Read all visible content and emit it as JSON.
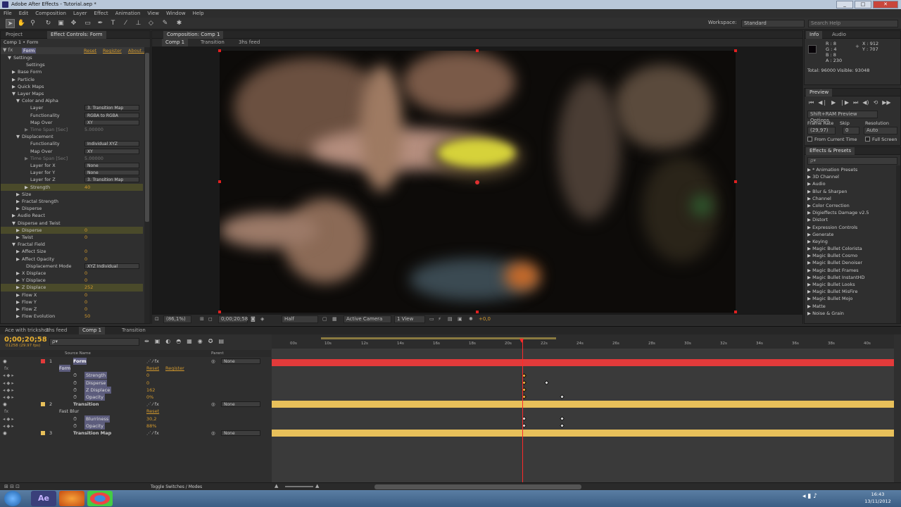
{
  "window": {
    "title": "Adobe After Effects - Tutorial.aep *"
  },
  "menu": [
    "File",
    "Edit",
    "Composition",
    "Layer",
    "Effect",
    "Animation",
    "View",
    "Window",
    "Help"
  ],
  "toolbar": {
    "workspace_label": "Workspace:",
    "workspace_value": "Standard",
    "search_placeholder": "Search Help"
  },
  "left_panel": {
    "tabs": [
      "Project",
      "Effect Controls: Form"
    ],
    "header": "Comp 1 • Form",
    "fx_name": "Form",
    "reset": "Reset",
    "register": "Register",
    "about": "About...",
    "rows": [
      {
        "label": "Settings",
        "indent": 1,
        "tri": "▼"
      },
      {
        "label": "Settings",
        "indent": 4,
        "tri": ""
      },
      {
        "label": "Base Form",
        "indent": 2,
        "tri": "▶"
      },
      {
        "label": "Particle",
        "indent": 2,
        "tri": "▶"
      },
      {
        "label": "Quick Maps",
        "indent": 2,
        "tri": "▶"
      },
      {
        "label": "Layer Maps",
        "indent": 2,
        "tri": "▼"
      },
      {
        "label": "Color and Alpha",
        "indent": 3,
        "tri": "▼"
      },
      {
        "label": "Layer",
        "indent": 5,
        "tri": "",
        "dd": "3. Transition Map"
      },
      {
        "label": "Functionality",
        "indent": 5,
        "tri": "",
        "dd": "RGBA to RGBA"
      },
      {
        "label": "Map Over",
        "indent": 5,
        "tri": "",
        "dd": "XY"
      },
      {
        "label": "Time Span [Sec]",
        "indent": 5,
        "tri": "▶",
        "val": "5.00000",
        "dim": true
      },
      {
        "label": "Displacement",
        "indent": 3,
        "tri": "▼"
      },
      {
        "label": "Functionality",
        "indent": 5,
        "tri": "",
        "dd": "Individual XYZ"
      },
      {
        "label": "Map Over",
        "indent": 5,
        "tri": "",
        "dd": "XY"
      },
      {
        "label": "Time Span [Sec]",
        "indent": 5,
        "tri": "▶",
        "val": "5.00000",
        "dim": true
      },
      {
        "label": "Layer for X",
        "indent": 5,
        "tri": "",
        "dd": "None"
      },
      {
        "label": "Layer for Y",
        "indent": 5,
        "tri": "",
        "dd": "None"
      },
      {
        "label": "Layer for Z",
        "indent": 5,
        "tri": "",
        "dd": "3. Transition Map"
      },
      {
        "label": "Strength",
        "indent": 5,
        "tri": "▶",
        "val": "40",
        "hl": true
      },
      {
        "label": "Size",
        "indent": 3,
        "tri": "▶"
      },
      {
        "label": "Fractal Strength",
        "indent": 3,
        "tri": "▶"
      },
      {
        "label": "Disperse",
        "indent": 3,
        "tri": "▶"
      },
      {
        "label": "Audio React",
        "indent": 2,
        "tri": "▶"
      },
      {
        "label": "Disperse and Twist",
        "indent": 2,
        "tri": "▼"
      },
      {
        "label": "Disperse",
        "indent": 3,
        "tri": "▶",
        "val": "0",
        "hl": true
      },
      {
        "label": "Twist",
        "indent": 3,
        "tri": "▶",
        "val": "0"
      },
      {
        "label": "Fractal Field",
        "indent": 2,
        "tri": "▼"
      },
      {
        "label": "Affect Size",
        "indent": 3,
        "tri": "▶",
        "val": "0"
      },
      {
        "label": "Affect Opacity",
        "indent": 3,
        "tri": "▶",
        "val": "0"
      },
      {
        "label": "Displacement Mode",
        "indent": 4,
        "tri": "",
        "dd": "XYZ Individual"
      },
      {
        "label": "X Displace",
        "indent": 3,
        "tri": "▶",
        "val": "0"
      },
      {
        "label": "Y Displace",
        "indent": 3,
        "tri": "▶",
        "val": "0"
      },
      {
        "label": "Z Displace",
        "indent": 3,
        "tri": "▶",
        "val": "252",
        "hl": true
      },
      {
        "label": "Flow X",
        "indent": 3,
        "tri": "▶",
        "val": "0"
      },
      {
        "label": "Flow Y",
        "indent": 3,
        "tri": "▶",
        "val": "0"
      },
      {
        "label": "Flow Z",
        "indent": 3,
        "tri": "▶",
        "val": "0"
      },
      {
        "label": "Flow Evolution",
        "indent": 3,
        "tri": "▶",
        "val": "50"
      }
    ]
  },
  "comp_panel": {
    "tab": "Composition: Comp 1",
    "subtabs": [
      "Comp 1",
      "Transition",
      "3hs feed"
    ],
    "zoom": "(86,1%)",
    "timecode": "0;00;20;58",
    "resolution": "Half",
    "camera": "Active Camera",
    "view": "1 View",
    "exposure": "+0,0"
  },
  "info_panel": {
    "tabs": [
      "Info",
      "Audio"
    ],
    "r": "R : 8",
    "g": "G : 4",
    "b": "B : 8",
    "a": "A : 230",
    "x": "X : 912",
    "y": "Y : 707",
    "total": "Total: 96000  Visible: 93048"
  },
  "preview_panel": {
    "tab": "Preview",
    "option": "Shift+RAM Preview Options",
    "frame_rate_label": "Frame Rate",
    "skip_label": "Skip",
    "resolution_label": "Resolution",
    "frame_rate": "(29,97)",
    "skip": "0",
    "resolution": "Auto",
    "from_current": "From Current Time",
    "full_screen": "Full Screen"
  },
  "effects_panel": {
    "tab": "Effects & Presets",
    "search_placeholder": "ρ▾",
    "items": [
      "* Animation Presets",
      "3D Channel",
      "Audio",
      "Blur & Sharpen",
      "Channel",
      "Color Correction",
      "Digieffects Damage v2.5",
      "Distort",
      "Expression Controls",
      "Generate",
      "Keying",
      "Magic Bullet Colorista",
      "Magic Bullet Cosmo",
      "Magic Bullet Denoiser",
      "Magic Bullet Frames",
      "Magic Bullet InstantHD",
      "Magic Bullet Looks",
      "Magic Bullet MisFire",
      "Magic Bullet Mojo",
      "Matte",
      "Noise & Grain"
    ]
  },
  "timeline": {
    "tabs": [
      "Ace with trickshot",
      "3hs feed",
      "Comp 1",
      "Transition"
    ],
    "timecode": "0;00;20;58",
    "frames": "01258 (29.97 fps)",
    "col_source": "Source Name",
    "col_parent": "Parent",
    "ruler": [
      "00s",
      "10s",
      "12s",
      "14s",
      "16s",
      "18s",
      "20s",
      "22s",
      "24s",
      "26s",
      "28s",
      "30s",
      "32s",
      "34s",
      "36s",
      "38s",
      "40s"
    ],
    "toggle_label": "Toggle Switches / Modes",
    "layers": [
      {
        "label": "1",
        "name": "Form",
        "parent": "None",
        "kind": "layer",
        "color": "#e23a3a"
      },
      {
        "label": "",
        "name": "Form",
        "kind": "fx",
        "reset": "Reset",
        "register": "Register"
      },
      {
        "label": "",
        "name": "Strength",
        "kind": "prop",
        "val": "0"
      },
      {
        "label": "",
        "name": "Disperse",
        "kind": "prop",
        "val": "0"
      },
      {
        "label": "",
        "name": "Z Displace",
        "kind": "prop",
        "val": "162"
      },
      {
        "label": "",
        "name": "Opacity",
        "kind": "prop",
        "val": "0%"
      },
      {
        "label": "2",
        "name": "Transition",
        "parent": "None",
        "kind": "layer",
        "color": "#e8c05a"
      },
      {
        "label": "",
        "name": "Fast Blur",
        "kind": "fx",
        "reset": "Reset"
      },
      {
        "label": "",
        "name": "Blurriness",
        "kind": "prop",
        "val": "30,2"
      },
      {
        "label": "",
        "name": "Opacity",
        "kind": "prop",
        "val": "88%"
      },
      {
        "label": "3",
        "name": "Transition Map",
        "parent": "None",
        "kind": "layer",
        "color": "#e8c05a"
      }
    ]
  },
  "taskbar": {
    "time": "16:43",
    "date": "13/11/2012"
  },
  "colors": {
    "accent": "#d49a2d",
    "form_track": "#e23a3a",
    "layer_track": "#e8c05a",
    "cti": "#ff2a2a"
  }
}
